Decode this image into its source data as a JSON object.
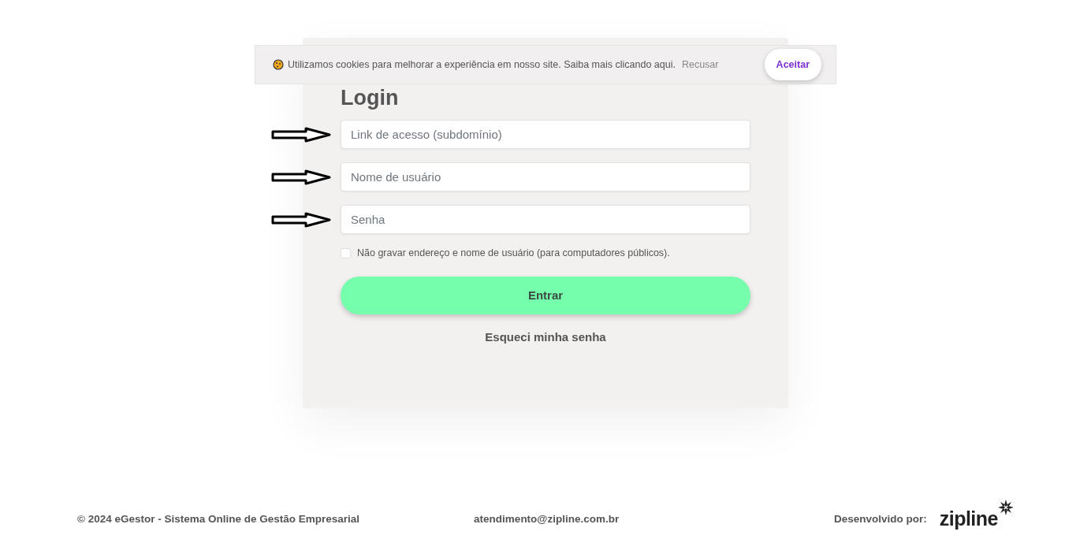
{
  "cookie_banner": {
    "message": "Utilizamos cookies para melhorar a experiência em nosso site. Saiba mais ",
    "link": "clicando aqui.",
    "decline": "Recusar",
    "accept": "Aceitar"
  },
  "login": {
    "title": "Login",
    "fields": [
      {
        "placeholder": "Link de acesso (subdomínio)"
      },
      {
        "placeholder": "Nome de usuário"
      },
      {
        "placeholder": "Senha"
      }
    ],
    "remember": {
      "label": "Não gravar endereço e nome de usuário (para computadores públicos).",
      "checked": false
    },
    "submit": "Entrar",
    "forgot": "Esqueci minha senha"
  },
  "footer": {
    "copyright": "© 2024 eGestor - Sistema Online de Gestão Empresarial",
    "email": "atendimento@zipline.com.br",
    "developed_by": "Desenvolvido por:",
    "logo": "zipline"
  }
}
